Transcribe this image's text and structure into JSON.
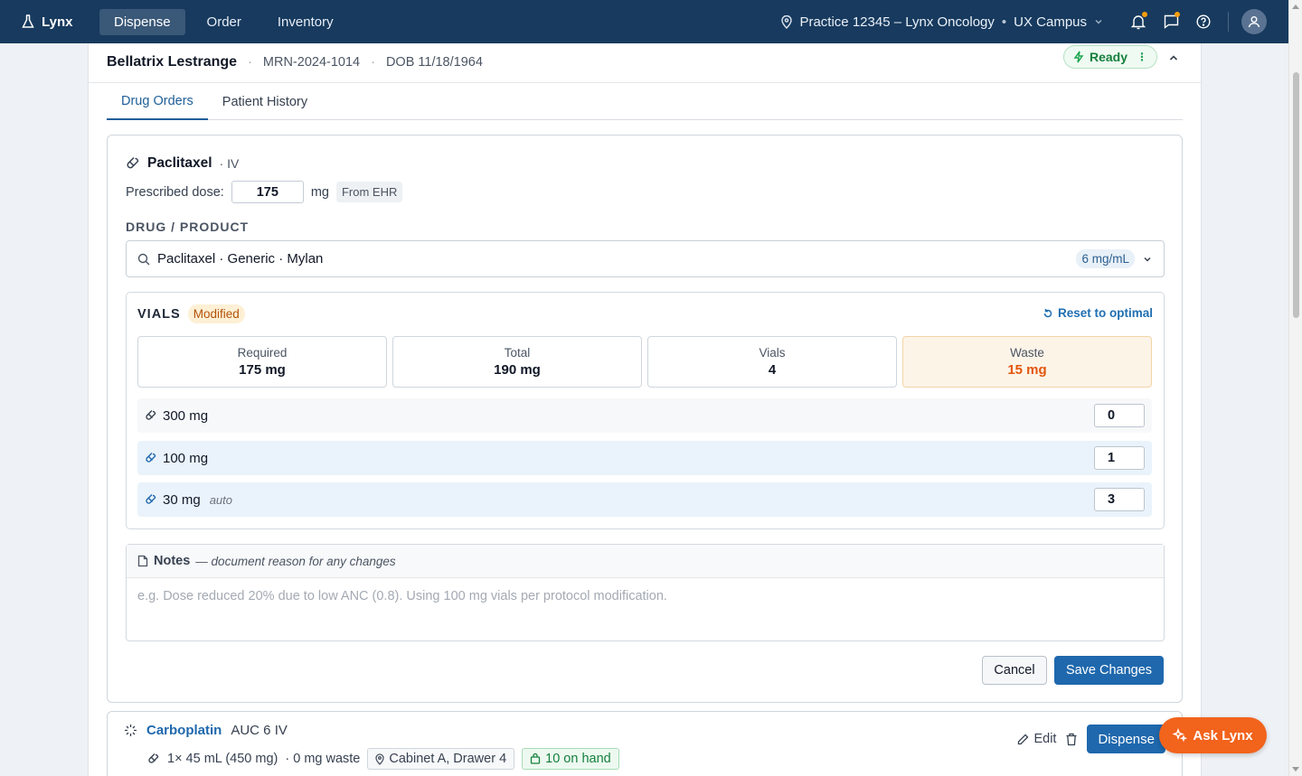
{
  "topbar": {
    "brand": "Lynx",
    "tabs": [
      {
        "label": "Dispense",
        "active": true
      },
      {
        "label": "Order",
        "active": false
      },
      {
        "label": "Inventory",
        "active": false
      }
    ],
    "practice": "Practice 12345 – Lynx Oncology",
    "campus": "UX Campus",
    "bg_color": "#173a5e",
    "notification_dot_color": "#f59e0b"
  },
  "patient": {
    "name": "Bellatrix Lestrange",
    "mrn": "MRN-2024-1014",
    "dob": "DOB 11/18/1964",
    "status": "Ready"
  },
  "tabs": [
    {
      "label": "Drug Orders",
      "active": true
    },
    {
      "label": "Patient History",
      "active": false
    }
  ],
  "drug": {
    "name": "Paclitaxel",
    "route": "· IV",
    "dose_label": "Prescribed dose:",
    "dose_value": "175",
    "dose_unit": "mg",
    "dose_source": "From EHR",
    "product_label": "DRUG / PRODUCT",
    "product": "Paclitaxel · Generic · Mylan",
    "concentration": "6 mg/mL"
  },
  "vials": {
    "label": "VIALS",
    "status": "Modified",
    "reset": "Reset to optimal",
    "stats": [
      {
        "key": "Required",
        "value": "175 mg"
      },
      {
        "key": "Total",
        "value": "190 mg"
      },
      {
        "key": "Vials",
        "value": "4"
      },
      {
        "key": "Waste",
        "value": "15 mg"
      }
    ],
    "rows": [
      {
        "size": "300 mg",
        "auto": "",
        "qty": "0"
      },
      {
        "size": "100 mg",
        "auto": "",
        "qty": "1"
      },
      {
        "size": "30 mg",
        "auto": "auto",
        "qty": "3"
      }
    ],
    "waste_color": "#e2560b"
  },
  "notes": {
    "title": "Notes",
    "hint": "— document reason for any changes",
    "placeholder": "e.g. Dose reduced 20% due to low ANC (0.8). Using 100 mg vials per protocol modification."
  },
  "actions": {
    "cancel": "Cancel",
    "save": "Save Changes"
  },
  "drug2": {
    "name": "Carboplatin",
    "meta": "AUC 6 IV",
    "vial": "1× 45 mL (450 mg)",
    "waste": "· 0 mg waste",
    "location": "Cabinet A, Drawer 4",
    "stock": "10 on hand",
    "edit": "Edit",
    "dispense": "Dispense"
  },
  "fab": {
    "label": "Ask Lynx",
    "color": "#f2631c"
  },
  "accent_color": "#1f68ad"
}
